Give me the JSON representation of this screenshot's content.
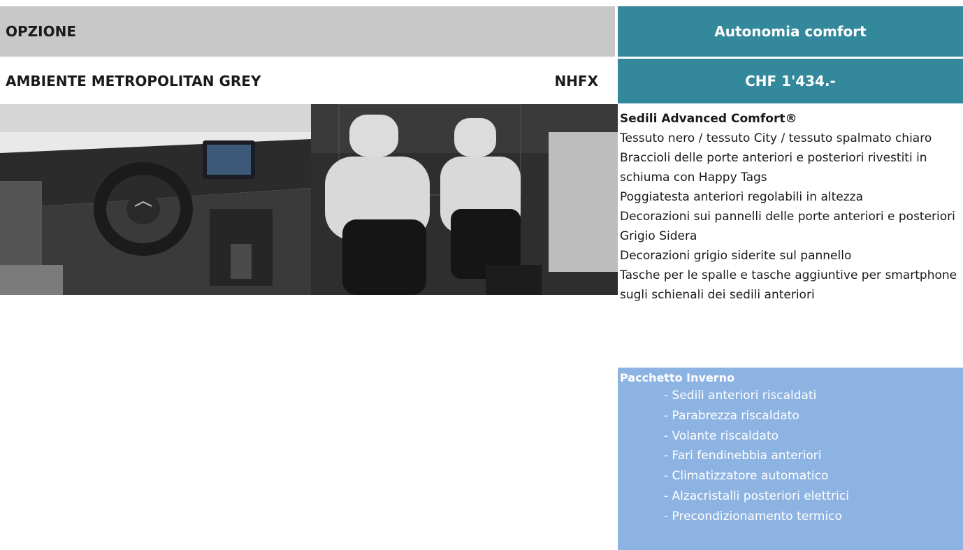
{
  "header": {
    "option_label": "OPZIONE",
    "version_label": "Autonomia comfort"
  },
  "ambiente": {
    "name": "AMBIENTE METROPOLITAN GREY",
    "code": "NHFX",
    "price": "CHF 1'434.-"
  },
  "features": {
    "title": "Sedili Advanced Comfort®",
    "items": [
      "Tessuto nero / tessuto City / tessuto spalmato chiaro",
      "Braccioli delle porte anteriori e posteriori rivestiti in schiuma con Happy Tags",
      "Poggiatesta anteriori regolabili in altezza",
      "Decorazioni sui pannelli delle porte anteriori e posteriori Grigio Sidera",
      "Decorazioni grigio siderite sul pannello",
      "Tasche per le spalle e tasche aggiuntive per smartphone sugli schienali dei sedili anteriori"
    ]
  },
  "pack": {
    "title": "Pacchetto Inverno",
    "items": [
      "- Sedili anteriori riscaldati",
      "- Parabrezza riscaldato",
      "- Volante riscaldato",
      "- Fari fendinebbia anteriori",
      "- Climatizzatore automatico",
      "- Alzacristalli posteriori elettrici",
      "- Precondizionamento termico"
    ]
  },
  "colors": {
    "header_grey": "#c8c8c8",
    "teal": "#33889b",
    "pack_blue": "#8db3e2"
  }
}
